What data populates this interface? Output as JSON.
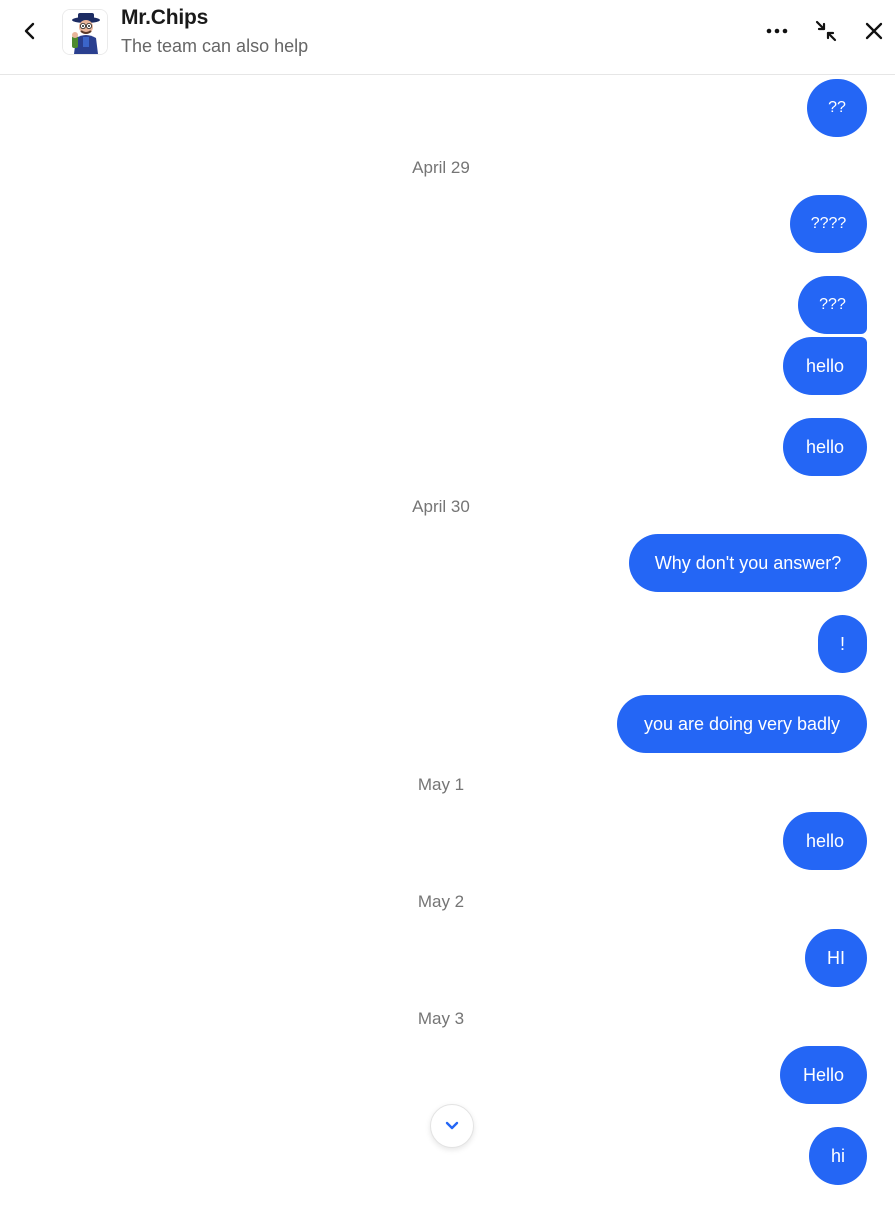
{
  "header": {
    "title": "Mr.Chips",
    "subtitle": "The team can also help"
  },
  "colors": {
    "accent": "#2466f5",
    "date_text": "#757575",
    "bubble_text": "#ffffff"
  },
  "icons": {
    "back": "chevron-left-icon",
    "more": "more-horizontal-icon",
    "collapse": "collapse-arrows-icon",
    "close": "close-icon",
    "scroll_down": "chevron-down-icon"
  },
  "thread": {
    "msg_0": "??",
    "date_1": "April 29",
    "msg_1": "????",
    "msg_2": "???",
    "msg_3": "hello",
    "msg_4": "hello",
    "date_2": "April 30",
    "msg_5": "Why don't you answer?",
    "msg_6": "!",
    "msg_7": "you are doing very badly",
    "date_3": "May 1",
    "msg_8": "hello",
    "date_4": "May 2",
    "msg_9": "HI",
    "date_5": "May 3",
    "msg_10": "Hello",
    "msg_11": "hi"
  }
}
